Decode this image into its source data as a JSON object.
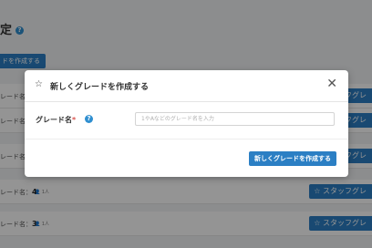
{
  "background": {
    "title": "定",
    "help_icon": "question-circle-icon",
    "add_button": "ドを作成する",
    "rows": [
      {
        "label_prefix": "レード名：",
        "label_value": "",
        "count": "",
        "button": "☆ スタッフグレ"
      },
      {
        "label_prefix": "レード名：",
        "label_value": "",
        "count": "",
        "button": "☆ スタッフグレ"
      },
      {
        "label_prefix": "レード名：",
        "label_value": "",
        "count": "",
        "button": "☆ スタッフグレ"
      },
      {
        "label_prefix": "レード名：",
        "label_value": "4",
        "count": "1人",
        "button": "☆ スタッフグレ"
      },
      {
        "label_prefix": "レード名：",
        "label_value": "3",
        "count": "1人",
        "button": "☆ スタッフグレ"
      }
    ]
  },
  "modal": {
    "title": "新しくグレードを作成する",
    "title_icon": "star-outline-icon",
    "close_icon": "close-icon",
    "field": {
      "label": "グレード名",
      "required_mark": "*",
      "help_icon": "question-circle-icon",
      "placeholder": "1やAなどのグレード名を入力",
      "value": ""
    },
    "submit_label": "新しくグレードを作成する"
  },
  "colors": {
    "primary": "#2b7fc4",
    "help": "#2f8fd0",
    "required": "#d9534f"
  }
}
